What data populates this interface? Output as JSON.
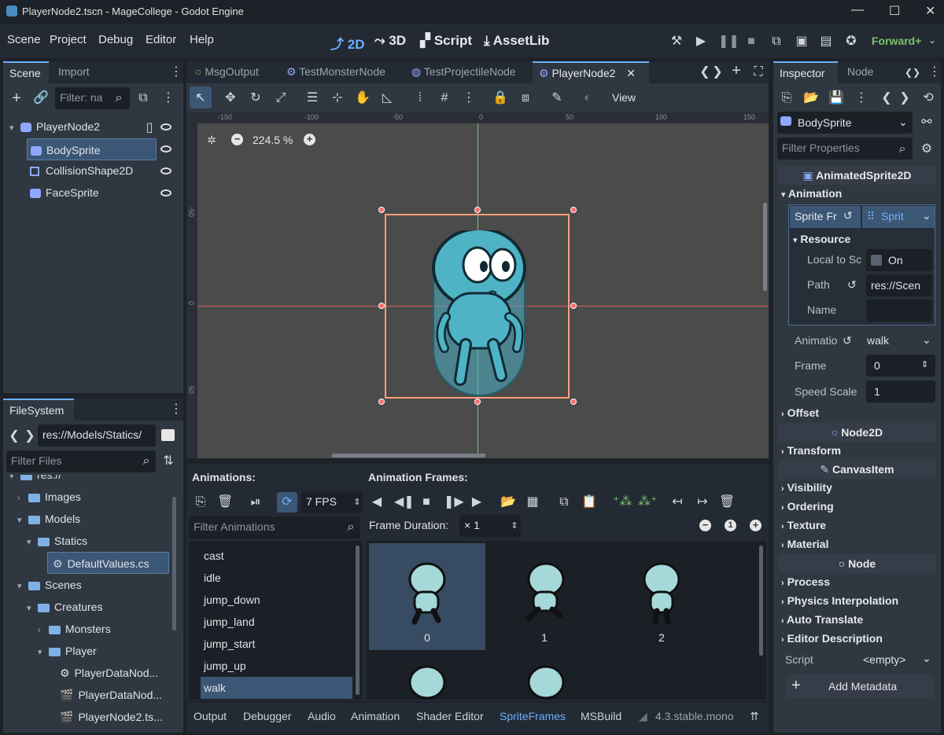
{
  "window": {
    "title": "PlayerNode2.tscn - MageCollege - Godot Engine"
  },
  "menu": {
    "items": [
      "Scene",
      "Project",
      "Debug",
      "Editor",
      "Help"
    ]
  },
  "workspaces": {
    "items": [
      "2D",
      "3D",
      "Script",
      "AssetLib"
    ],
    "active": "2D"
  },
  "renderer": "Forward+",
  "scene_dock": {
    "tabs": [
      "Scene",
      "Import"
    ],
    "filter_placeholder": "Filter: na",
    "nodes": [
      {
        "name": "PlayerNode2",
        "selected": false
      },
      {
        "name": "BodySprite",
        "selected": true
      },
      {
        "name": "CollisionShape2D",
        "selected": false
      },
      {
        "name": "FaceSprite",
        "selected": false
      }
    ]
  },
  "filesystem": {
    "tab": "FileSystem",
    "path": "res://Models/Statics/",
    "filter_placeholder": "Filter Files",
    "items": [
      {
        "name": "res://",
        "type": "folder"
      },
      {
        "name": "Images",
        "type": "folder"
      },
      {
        "name": "Models",
        "type": "folder"
      },
      {
        "name": "Statics",
        "type": "folder"
      },
      {
        "name": "DefaultValues.cs",
        "type": "file"
      },
      {
        "name": "Scenes",
        "type": "folder"
      },
      {
        "name": "Creatures",
        "type": "folder"
      },
      {
        "name": "Monsters",
        "type": "folder"
      },
      {
        "name": "Player",
        "type": "folder"
      },
      {
        "name": "PlayerDataNod...",
        "type": "file"
      },
      {
        "name": "PlayerDataNod...",
        "type": "file"
      },
      {
        "name": "PlayerNode2.ts...",
        "type": "file"
      }
    ]
  },
  "editor_tabs": {
    "items": [
      "MsgOutput",
      "TestMonsterNode",
      "TestProjectileNode",
      "PlayerNode2"
    ],
    "active": "PlayerNode2"
  },
  "viewport_toolbar": {
    "view_label": "View"
  },
  "viewport": {
    "zoom": "224.5 %",
    "ruler_h": [
      "-150",
      "-100",
      "-50",
      "0",
      "50",
      "100",
      "150"
    ],
    "ruler_v": [
      "-50",
      "0",
      "50"
    ]
  },
  "inspector": {
    "tabs": [
      "Inspector",
      "Node"
    ],
    "object": "BodySprite",
    "filter_placeholder": "Filter Properties",
    "class_header": "AnimatedSprite2D",
    "animation_cat": "Animation",
    "sprite_frames_label": "Sprite Fr",
    "sprite_frames_value": "Sprit",
    "resource_cat": "Resource",
    "local_to_scene_label": "Local to Sc",
    "local_to_scene_value": "On",
    "path_label": "Path",
    "path_value": "res://Scen",
    "name_label": "Name",
    "animation_label": "Animatio",
    "animation_value": "walk",
    "frame_label": "Frame",
    "frame_value": "0",
    "speed_scale_label": "Speed Scale",
    "speed_scale_value": "1",
    "offset_cat": "Offset",
    "node2d_header": "Node2D",
    "transform_cat": "Transform",
    "canvasitem_header": "CanvasItem",
    "visibility_cat": "Visibility",
    "ordering_cat": "Ordering",
    "texture_cat": "Texture",
    "material_cat": "Material",
    "node_header": "Node",
    "process_cat": "Process",
    "physics_cat": "Physics Interpolation",
    "autotranslate_cat": "Auto Translate",
    "editordesc_cat": "Editor Description",
    "script_label": "Script",
    "script_value": "<empty>",
    "add_metadata": "Add Metadata"
  },
  "spriteframes": {
    "animations_title": "Animations:",
    "frames_title": "Animation Frames:",
    "fps": "7 FPS",
    "filter_placeholder": "Filter Animations",
    "frame_duration_label": "Frame Duration:",
    "frame_duration_value": "× 1",
    "animations": [
      "cast",
      "idle",
      "jump_down",
      "jump_land",
      "jump_start",
      "jump_up",
      "walk"
    ],
    "selected_animation": "walk",
    "frames": [
      "0",
      "1",
      "2"
    ]
  },
  "bottom_panel": {
    "tabs": [
      "Output",
      "Debugger",
      "Audio",
      "Animation",
      "Shader Editor",
      "SpriteFrames",
      "MSBuild"
    ],
    "active": "SpriteFrames",
    "version": "4.3.stable.mono"
  },
  "colors": {
    "accent": "#6ab0ff",
    "selection": "#3c5675",
    "panel": "#242a33",
    "viewport": "#4b4b4b",
    "selection_rect": "#ff9f7a"
  }
}
